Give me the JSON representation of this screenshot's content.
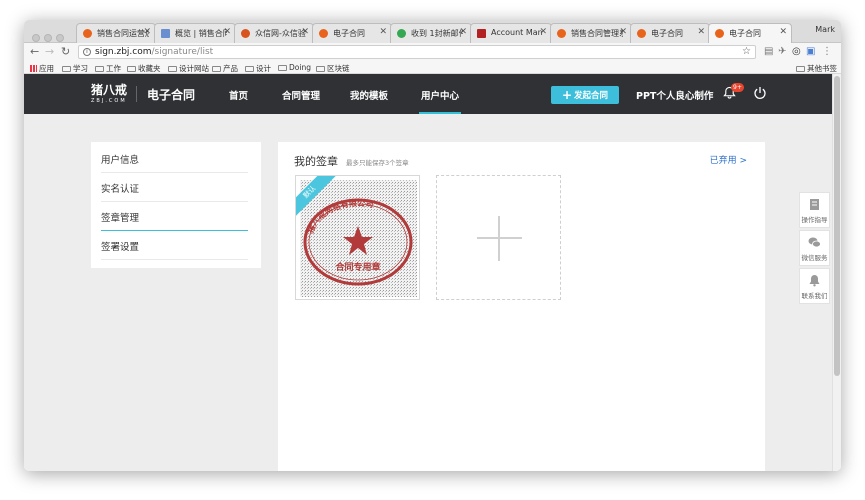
{
  "browser": {
    "tabs": [
      {
        "label": "销售合同运营后",
        "icon": "order-icon"
      },
      {
        "label": "概览 | 销售合同",
        "icon": "chart-icon"
      },
      {
        "label": "众信网-众信验证",
        "icon": "zx-icon"
      },
      {
        "label": "电子合同",
        "icon": "order-icon"
      },
      {
        "label": "收到 1封新邮件",
        "icon": "mail-icon"
      },
      {
        "label": "Account Mana",
        "icon": "account-icon"
      },
      {
        "label": "销售合同管理系",
        "icon": "order-icon"
      },
      {
        "label": "电子合同",
        "icon": "order-icon"
      },
      {
        "label": "电子合同",
        "icon": "order-icon"
      }
    ],
    "user_name": "Mark",
    "url_host": "sign.zbj.com",
    "url_path": "/signature/list",
    "bookmarks": [
      "应用",
      "学习",
      "工作",
      "收藏夹",
      "设计网站",
      "产品",
      "设计",
      "Doing",
      "区块链"
    ],
    "other_bookmarks": "其他书签"
  },
  "header": {
    "logo_text": "猪八戒",
    "logo_sub": "ZBJ.COM",
    "product": "电子合同",
    "nav": [
      "首页",
      "合同管理",
      "我的模板",
      "用户中心"
    ],
    "launch_button": "发起合同",
    "ppt_link": "PPT个人良心制作",
    "badge": "9+"
  },
  "sidebar": {
    "items": [
      "用户信息",
      "实名认证",
      "签章管理",
      "签署设置"
    ]
  },
  "content": {
    "title": "我的签章",
    "hint": "最多只能保存3个签章",
    "abandoned_link": "已弃用 >",
    "default_ribbon": "默认",
    "seal_bottom_text": "合同专用章",
    "seal_top_text": "猪八戒网络有限公司"
  },
  "tools": [
    "操作指导",
    "微信服务",
    "联系我们"
  ],
  "colors": {
    "header_bg": "#2f3134",
    "accent": "#3dbfdb",
    "link": "#2f72c9",
    "seal_red": "#b23a3a"
  }
}
